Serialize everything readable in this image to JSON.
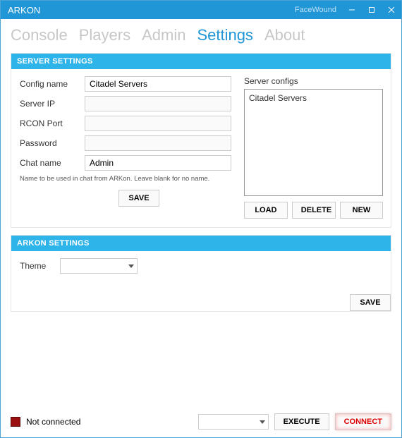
{
  "titlebar": {
    "app_title": "ARKON",
    "subtitle": "FaceWound"
  },
  "tabs": {
    "items": [
      "Console",
      "Players",
      "Admin",
      "Settings",
      "About"
    ],
    "active_index": 3
  },
  "server_settings": {
    "header": "SERVER SETTINGS",
    "labels": {
      "config_name": "Config name",
      "server_ip": "Server IP",
      "rcon_port": "RCON Port",
      "password": "Password",
      "chat_name": "Chat name"
    },
    "values": {
      "config_name": "Citadel Servers",
      "server_ip": "",
      "rcon_port": "",
      "password": "",
      "chat_name": "Admin"
    },
    "help_text": "Name to be used in chat from ARKon. Leave blank for no name.",
    "save_label": "SAVE",
    "configs_label": "Server configs",
    "configs": [
      "Citadel Servers"
    ],
    "buttons": {
      "load": "LOAD",
      "delete": "DELETE",
      "new": "NEW"
    }
  },
  "arkon_settings": {
    "header": "ARKON SETTINGS",
    "theme_label": "Theme",
    "theme_value": "",
    "save_label": "SAVE"
  },
  "footer": {
    "status_text": "Not connected",
    "status_color": "#9a1010",
    "command_value": "",
    "execute_label": "EXECUTE",
    "connect_label": "CONNECT"
  }
}
